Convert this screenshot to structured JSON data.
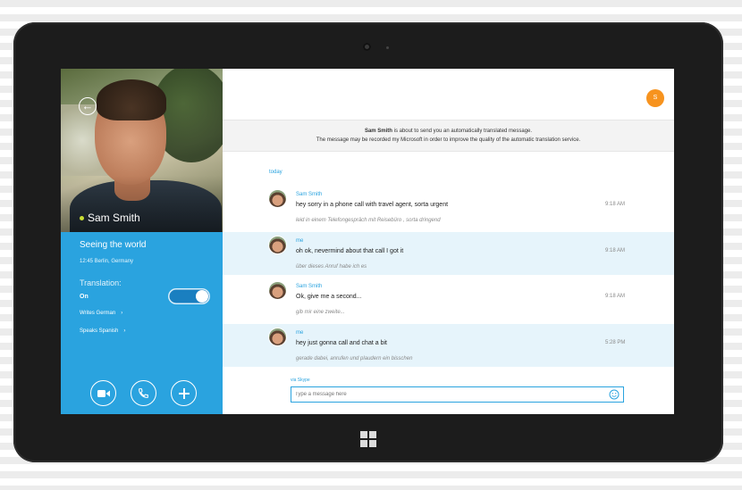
{
  "contact": {
    "name": "Sam Smith",
    "mood": "Seeing the world",
    "location": "12:45 Berlin, Germany",
    "status_color": "#c9de33"
  },
  "translation": {
    "label": "Translation:",
    "state": "On",
    "enabled": true,
    "writes": "Writes German",
    "speaks": "Speaks Spanish"
  },
  "actions": {
    "video_icon": "video-camera-icon",
    "call_icon": "phone-icon",
    "add_icon": "plus-icon"
  },
  "me": {
    "avatar_letter": "S",
    "avatar_color": "#f7931e"
  },
  "notice": {
    "sender": "Sam Smith",
    "line1": "is about to send you an automatically translated message.",
    "line2": "The message may be recorded my Microsoft in order to improve the quality of the automatic translation service."
  },
  "conversation": {
    "day_label": "today",
    "messages": [
      {
        "sender": "Sam Smith",
        "text": "hey sorry in a phone call with travel agent, sorta urgent",
        "translation": "leid in einem Telefongespräch mit Reisebüro , sorta dringend",
        "time": "9:18 AM"
      },
      {
        "sender": "me",
        "text": "oh ok, nevermind about that call I got it",
        "translation": "über dieses Anruf habe ich es",
        "time": "9:18 AM"
      },
      {
        "sender": "Sam Smith",
        "text": "Ok, give me a second...",
        "translation": "gib mir eine zweite...",
        "time": "9:18 AM"
      },
      {
        "sender": "me",
        "text": "hey just gonna call and chat a bit",
        "translation": "gerade dabei, anrufen und plaudern ein bisschen",
        "time": "5:28 PM"
      }
    ]
  },
  "composer": {
    "via": "via Skype",
    "placeholder": "Type a message here",
    "emoji_icon": "smiley-icon"
  },
  "colors": {
    "accent": "#2aa3df",
    "highlight_row": "#e6f4fb"
  }
}
